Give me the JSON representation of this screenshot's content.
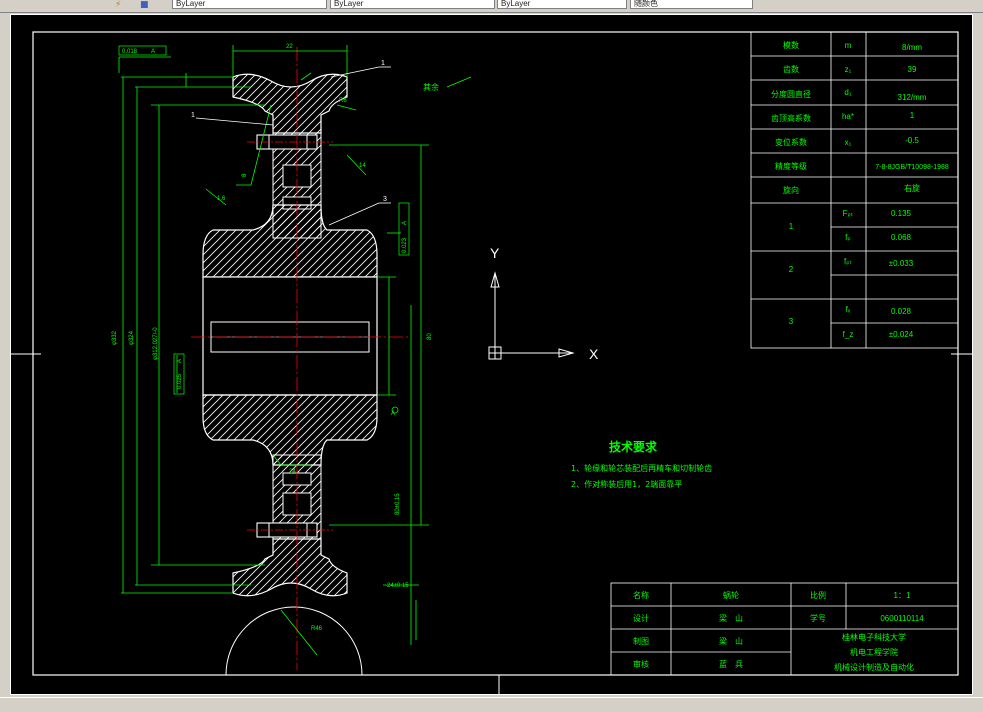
{
  "toolbar": {
    "icons": [
      "draw-order-icon",
      "layer-icon"
    ],
    "dropdowns": [
      "ByLayer",
      "ByLayer",
      "ByLayer",
      "随颜色"
    ]
  },
  "axes": {
    "y_label": "Y",
    "x_label": "X"
  },
  "drawing": {
    "surface_finish_note": "其余",
    "balloons": [
      "1",
      "1",
      "2",
      "3"
    ],
    "dims": {
      "top_width": "22",
      "tol_top": "0.018",
      "tol_top_ref": "A",
      "tol_mid": "0.023",
      "tol_mid_ref": "A",
      "tol_left": "0.025",
      "tol_left_ref": "A",
      "od_left": "φ332",
      "od_left2": "φ324",
      "pitch_dia": "φ312.027/-0",
      "bore_height": "80",
      "ref_a": "A",
      "right_long": "80±0.15",
      "right_bottom": "24±0.15",
      "hub_w": "24",
      "small_1": "14",
      "small_2": "1.6",
      "r_arc": "R6",
      "slot_dim": "8",
      "bottom_r": "R46"
    }
  },
  "params_table": {
    "rows": [
      {
        "label": "模数",
        "sym": "m",
        "val": "8/mm"
      },
      {
        "label": "齿数",
        "sym": "z₁",
        "val": "39"
      },
      {
        "label": "分度圆直径",
        "sym": "d₁",
        "val": "312/mm"
      },
      {
        "label": "齿顶高系数",
        "sym": "ha*",
        "val": "1"
      },
      {
        "label": "变位系数",
        "sym": "x₁",
        "val": "-0.5"
      },
      {
        "label": "精度等级",
        "sym": "",
        "val": "7-8-8JGB/T10098-1988"
      },
      {
        "label": "旋向",
        "sym": "",
        "val": "右旋"
      }
    ],
    "groups": [
      {
        "label": "1",
        "r1_sym": "Fₚₜ",
        "r1_val": "0.135",
        "r2_sym": "fₚ",
        "r2_val": "0.068"
      },
      {
        "label": "2",
        "r1_sym": "fₚₜ",
        "r1_val": "±0.033",
        "r2_sym": "",
        "r2_val": ""
      },
      {
        "label": "3",
        "r1_sym": "fₓ",
        "r1_val": "0.028",
        "r2_sym": "f_z",
        "r2_val": "±0.024"
      }
    ]
  },
  "tech_req": {
    "title": "技术要求",
    "items": [
      "1、轮缘和轮芯装配后再精车和切制轮齿",
      "2、作对称装后用1，2端面靠平"
    ]
  },
  "title_block": {
    "name_label": "名称",
    "name_val": "蜗轮",
    "scale_label": "比例",
    "scale_val": "1：1",
    "design_label": "设计",
    "design_val": "梁　山",
    "student_label": "学号",
    "student_val": "0600110114",
    "draw_label": "制图",
    "draw_val": "梁　山",
    "review_label": "审核",
    "review_val": "蓝　兵",
    "school_1": "桂林电子科技大学",
    "school_2": "机电工程学院",
    "school_3": "机械设计制造及自动化"
  },
  "colors": {
    "model_bg": "#000000",
    "frame": "#ffffff",
    "dims": "#00ff00",
    "center": "#ff0000",
    "hatch": "#ffffff",
    "table_text": "#00ff00"
  }
}
